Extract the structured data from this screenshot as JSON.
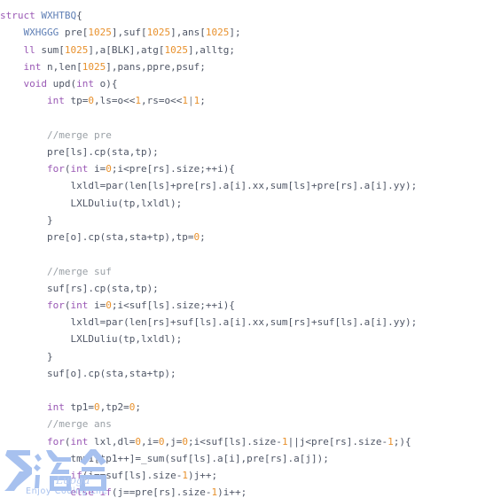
{
  "editor": {
    "language": "cpp",
    "background_color": "#ffffff",
    "font_size_px": 11,
    "line_height_px": 19.22,
    "colors": {
      "default": "#4f5666",
      "keyword": "#9a59b5",
      "type_name": "#5f7fb5",
      "number": "#e8912d",
      "comment": "#9aa0a6",
      "operator": "#7c8391"
    }
  },
  "watermark": {
    "logo_mark": "々",
    "brand_cn": "洛谷",
    "brand_script": "Luogu",
    "tagline": "Enjoy Coding Life",
    "color": "#a7c1ef"
  },
  "code": {
    "lines": [
      [
        {
          "t": "",
          "c": "def"
        }
      ],
      [
        {
          "t": "struct ",
          "c": "kw"
        },
        {
          "t": "WXHTBQ",
          "c": "type"
        },
        {
          "t": "{",
          "c": "def"
        }
      ],
      [
        {
          "t": "    ",
          "c": "def"
        },
        {
          "t": "WXHGGG",
          "c": "type"
        },
        {
          "t": " pre[",
          "c": "def"
        },
        {
          "t": "1025",
          "c": "num"
        },
        {
          "t": "],suf[",
          "c": "def"
        },
        {
          "t": "1025",
          "c": "num"
        },
        {
          "t": "],ans[",
          "c": "def"
        },
        {
          "t": "1025",
          "c": "num"
        },
        {
          "t": "];",
          "c": "def"
        }
      ],
      [
        {
          "t": "    ",
          "c": "def"
        },
        {
          "t": "ll",
          "c": "kw"
        },
        {
          "t": " sum[",
          "c": "def"
        },
        {
          "t": "1025",
          "c": "num"
        },
        {
          "t": "],a[BLK],atg[",
          "c": "def"
        },
        {
          "t": "1025",
          "c": "num"
        },
        {
          "t": "],alltg;",
          "c": "def"
        }
      ],
      [
        {
          "t": "    ",
          "c": "def"
        },
        {
          "t": "int",
          "c": "kw"
        },
        {
          "t": " n,len[",
          "c": "def"
        },
        {
          "t": "1025",
          "c": "num"
        },
        {
          "t": "],pans,ppre,psuf;",
          "c": "def"
        }
      ],
      [
        {
          "t": "    ",
          "c": "def"
        },
        {
          "t": "void",
          "c": "kw"
        },
        {
          "t": " upd(",
          "c": "def"
        },
        {
          "t": "int",
          "c": "kw"
        },
        {
          "t": " o){",
          "c": "def"
        }
      ],
      [
        {
          "t": "        ",
          "c": "def"
        },
        {
          "t": "int",
          "c": "kw"
        },
        {
          "t": " tp=",
          "c": "def"
        },
        {
          "t": "0",
          "c": "num"
        },
        {
          "t": ",ls=o<<",
          "c": "def"
        },
        {
          "t": "1",
          "c": "num"
        },
        {
          "t": ",rs=o<<",
          "c": "def"
        },
        {
          "t": "1",
          "c": "num"
        },
        {
          "t": "|",
          "c": "op"
        },
        {
          "t": "1",
          "c": "num"
        },
        {
          "t": ";",
          "c": "def"
        }
      ],
      [
        {
          "t": "",
          "c": "def"
        }
      ],
      [
        {
          "t": "        ",
          "c": "def"
        },
        {
          "t": "//merge pre",
          "c": "com"
        }
      ],
      [
        {
          "t": "        pre[ls].cp(sta,tp);",
          "c": "def"
        }
      ],
      [
        {
          "t": "        ",
          "c": "def"
        },
        {
          "t": "for",
          "c": "kw"
        },
        {
          "t": "(",
          "c": "def"
        },
        {
          "t": "int",
          "c": "kw"
        },
        {
          "t": " i=",
          "c": "def"
        },
        {
          "t": "0",
          "c": "num"
        },
        {
          "t": ";i<pre[rs].size;++i){",
          "c": "def"
        }
      ],
      [
        {
          "t": "            lxldl=par(len[ls]+pre[rs].a[i].xx,sum[ls]+pre[rs].a[i].yy);",
          "c": "def"
        }
      ],
      [
        {
          "t": "            LXLDuliu(tp,lxldl);",
          "c": "def"
        }
      ],
      [
        {
          "t": "        }",
          "c": "def"
        }
      ],
      [
        {
          "t": "        pre[o].cp(sta,sta+tp),tp=",
          "c": "def"
        },
        {
          "t": "0",
          "c": "num"
        },
        {
          "t": ";",
          "c": "def"
        }
      ],
      [
        {
          "t": "",
          "c": "def"
        }
      ],
      [
        {
          "t": "        ",
          "c": "def"
        },
        {
          "t": "//merge suf",
          "c": "com"
        }
      ],
      [
        {
          "t": "        suf[rs].cp(sta,tp);",
          "c": "def"
        }
      ],
      [
        {
          "t": "        ",
          "c": "def"
        },
        {
          "t": "for",
          "c": "kw"
        },
        {
          "t": "(",
          "c": "def"
        },
        {
          "t": "int",
          "c": "kw"
        },
        {
          "t": " i=",
          "c": "def"
        },
        {
          "t": "0",
          "c": "num"
        },
        {
          "t": ";i<suf[ls].size;++i){",
          "c": "def"
        }
      ],
      [
        {
          "t": "            lxldl=par(len[rs]+suf[ls].a[i].xx,sum[rs]+suf[ls].a[i].yy);",
          "c": "def"
        }
      ],
      [
        {
          "t": "            LXLDuliu(tp,lxldl);",
          "c": "def"
        }
      ],
      [
        {
          "t": "        }",
          "c": "def"
        }
      ],
      [
        {
          "t": "        suf[o].cp(sta,sta+tp);",
          "c": "def"
        }
      ],
      [
        {
          "t": "",
          "c": "def"
        }
      ],
      [
        {
          "t": "        ",
          "c": "def"
        },
        {
          "t": "int",
          "c": "kw"
        },
        {
          "t": " tp1=",
          "c": "def"
        },
        {
          "t": "0",
          "c": "num"
        },
        {
          "t": ",tp2=",
          "c": "def"
        },
        {
          "t": "0",
          "c": "num"
        },
        {
          "t": ";",
          "c": "def"
        }
      ],
      [
        {
          "t": "        ",
          "c": "def"
        },
        {
          "t": "//merge ans",
          "c": "com"
        }
      ],
      [
        {
          "t": "        ",
          "c": "def"
        },
        {
          "t": "for",
          "c": "kw"
        },
        {
          "t": "(",
          "c": "def"
        },
        {
          "t": "int",
          "c": "kw"
        },
        {
          "t": " lxl,dl=",
          "c": "def"
        },
        {
          "t": "0",
          "c": "num"
        },
        {
          "t": ",i=",
          "c": "def"
        },
        {
          "t": "0",
          "c": "num"
        },
        {
          "t": ",j=",
          "c": "def"
        },
        {
          "t": "0",
          "c": "num"
        },
        {
          "t": ";i<suf[ls].size-",
          "c": "def"
        },
        {
          "t": "1",
          "c": "num"
        },
        {
          "t": "||j<pre[rs].size-",
          "c": "def"
        },
        {
          "t": "1",
          "c": "num"
        },
        {
          "t": ";){",
          "c": "def"
        }
      ],
      [
        {
          "t": "            tmp1[tp1++]=_sum(suf[ls].a[i],pre[rs].a[j]);",
          "c": "def"
        }
      ],
      [
        {
          "t": "            ",
          "c": "def"
        },
        {
          "t": "if",
          "c": "kw"
        },
        {
          "t": "(i==suf[ls].size-",
          "c": "def"
        },
        {
          "t": "1",
          "c": "num"
        },
        {
          "t": ")j++;",
          "c": "def"
        }
      ],
      [
        {
          "t": "            ",
          "c": "def"
        },
        {
          "t": "else",
          "c": "kw"
        },
        {
          "t": " ",
          "c": "def"
        },
        {
          "t": "if",
          "c": "kw"
        },
        {
          "t": "(j==pre[rs].size-",
          "c": "def"
        },
        {
          "t": "1",
          "c": "num"
        },
        {
          "t": ")i++;",
          "c": "def"
        }
      ]
    ]
  }
}
